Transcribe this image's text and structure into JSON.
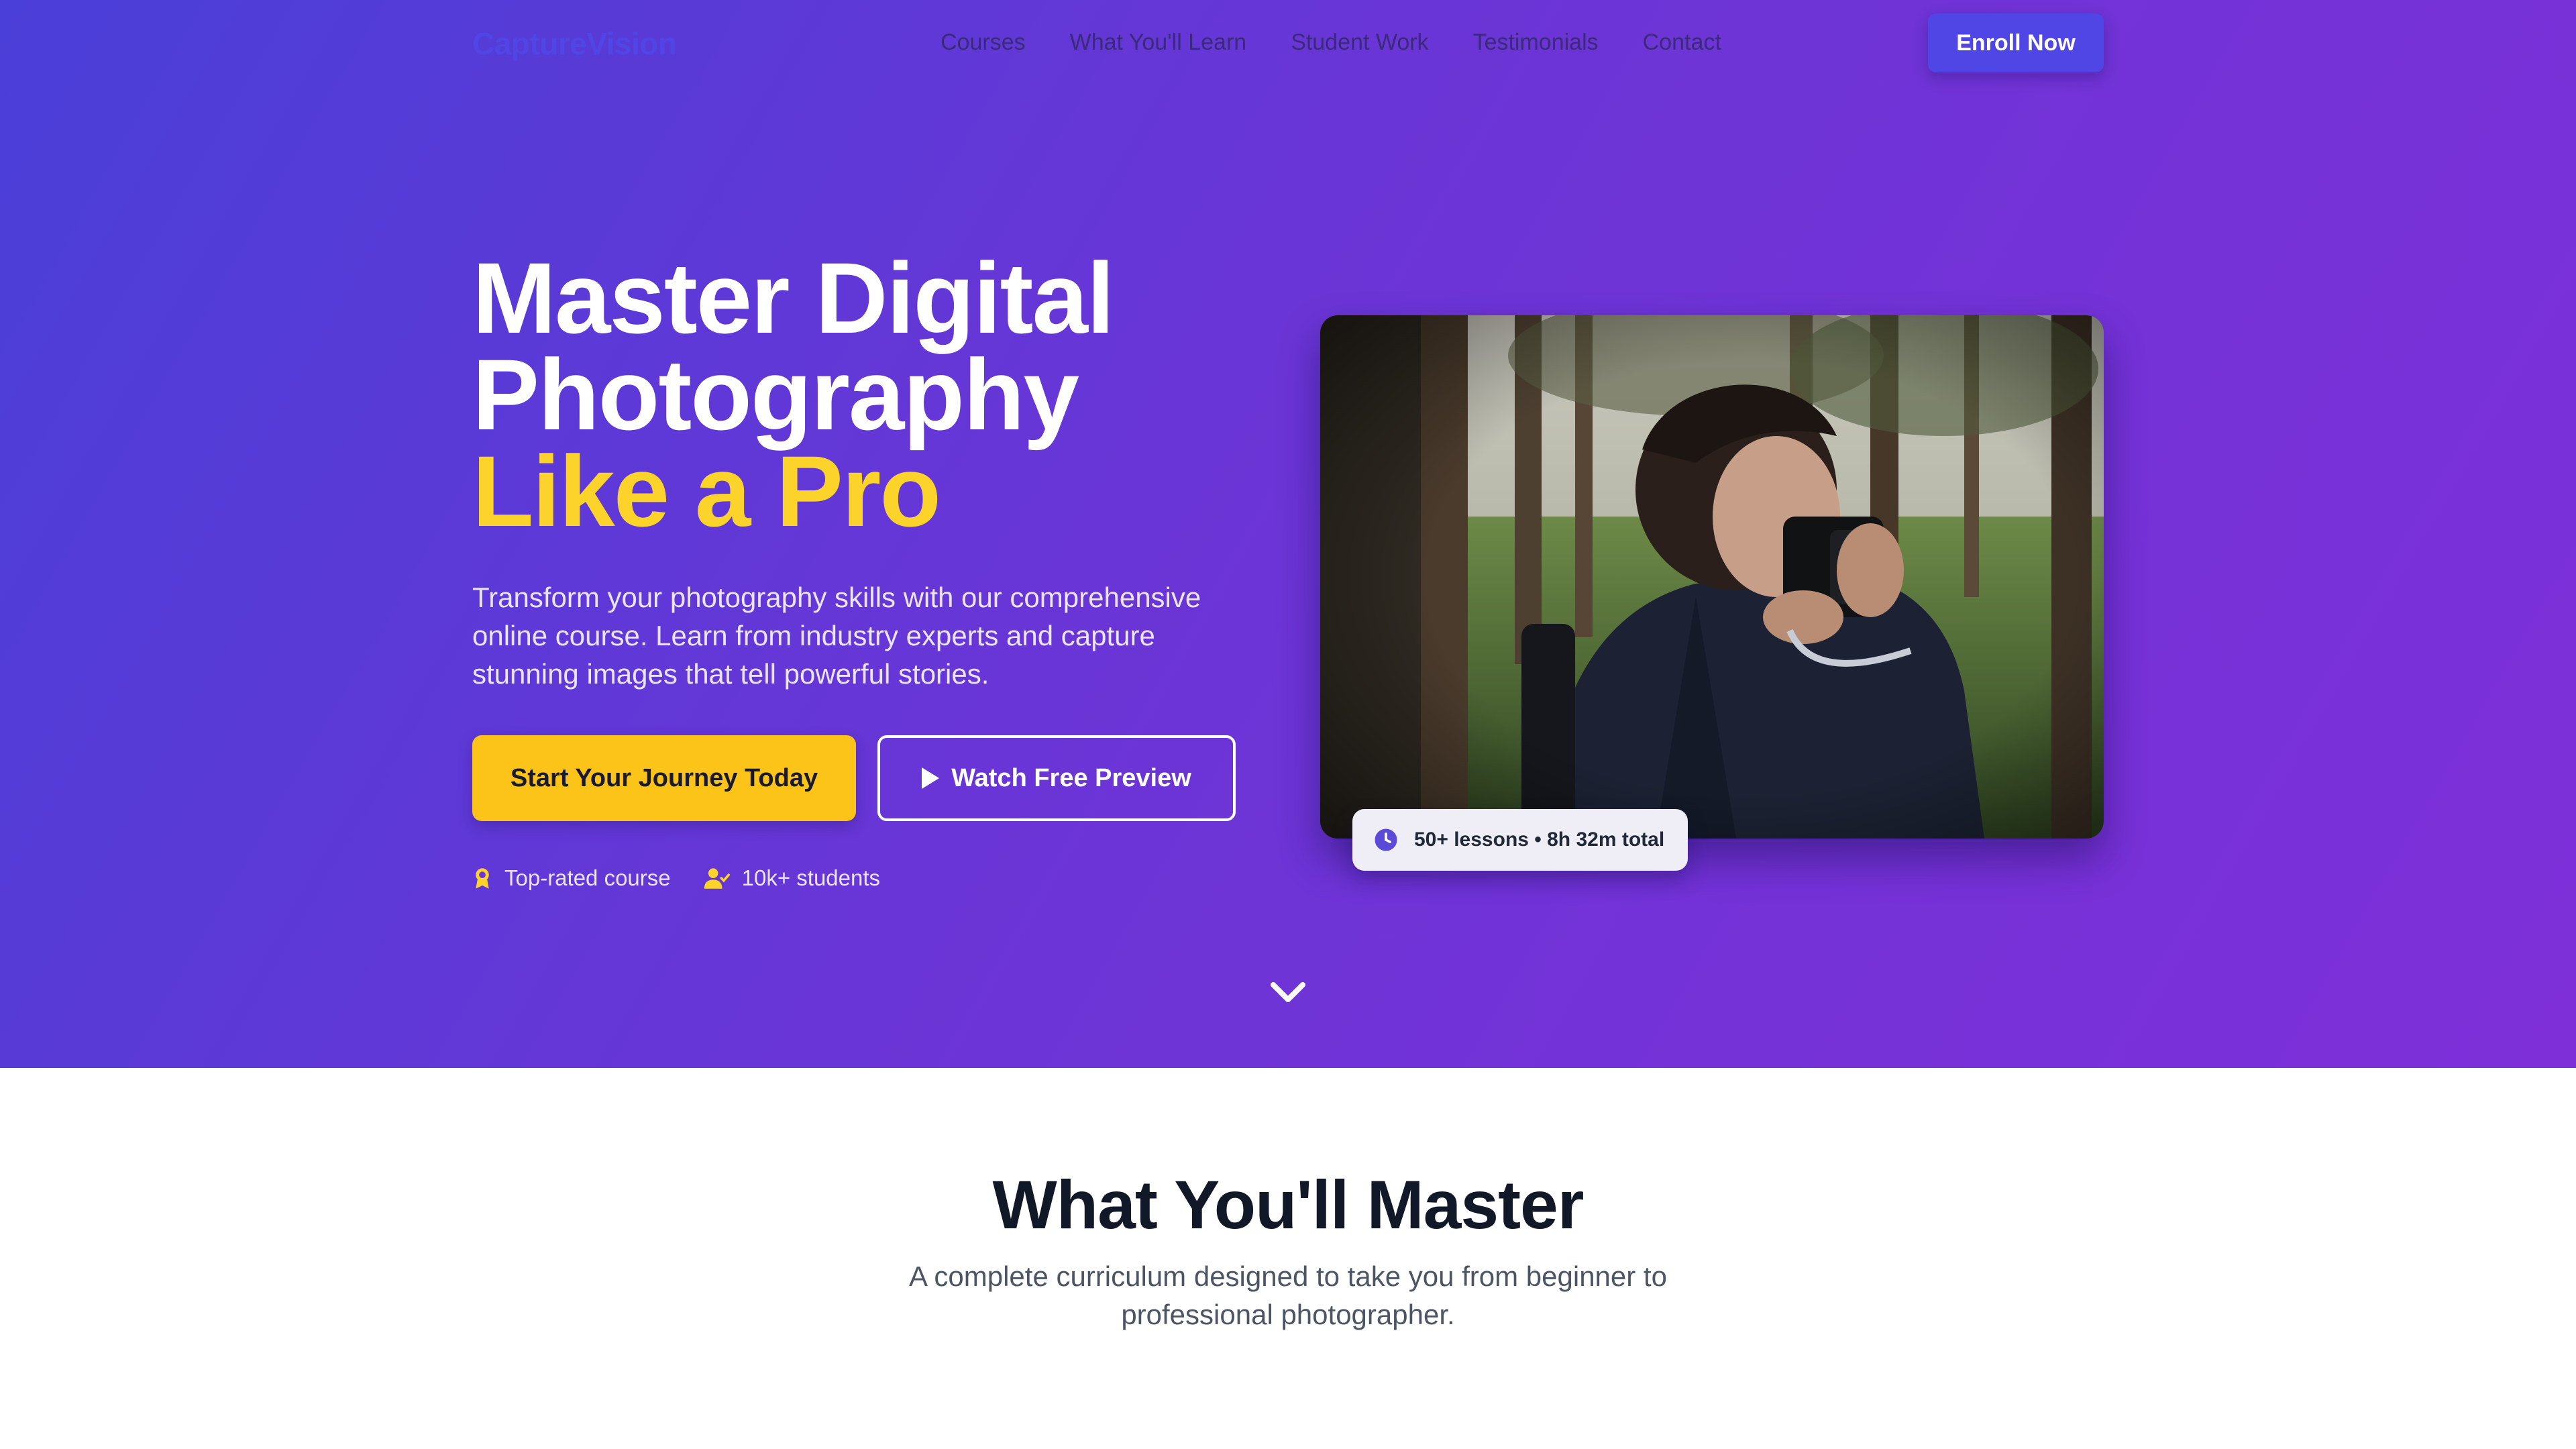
{
  "nav": {
    "logo": "CaptureVision",
    "links": [
      "Courses",
      "What You'll Learn",
      "Student Work",
      "Testimonials",
      "Contact"
    ],
    "cta": "Enroll Now"
  },
  "hero": {
    "headline_line1": "Master Digital",
    "headline_line2": "Photography",
    "headline_accent": "Like a Pro",
    "subtext": "Transform your photography skills with our comprehensive online course. Learn from industry experts and capture stunning images that tell powerful stories.",
    "primary_button": "Start Your Journey Today",
    "secondary_button": "Watch Free Preview",
    "badges": [
      {
        "icon": "award-icon",
        "label": "Top-rated course"
      },
      {
        "icon": "user-check-icon",
        "label": "10k+ students"
      }
    ],
    "stats": "50+ lessons • 8h 32m total"
  },
  "section": {
    "title": "What You'll Master",
    "subtitle": "A complete curriculum designed to take you from beginner to professional photographer."
  },
  "colors": {
    "accent": "#fcd32a",
    "brand": "#4f46e5",
    "hero_start": "#4a3fd8",
    "hero_end": "#7e2fd8"
  }
}
